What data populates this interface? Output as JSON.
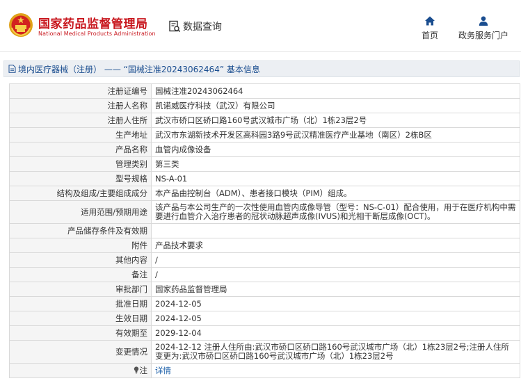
{
  "header": {
    "brand_cn": "国家药品监督管理局",
    "brand_en": "National Medical Products Administration",
    "data_query_label": "数据查询",
    "nav": {
      "home_label": "首页",
      "gov_service_label": "政务服务门户"
    }
  },
  "breadcrumb": {
    "text": "境内医疗器械（注册） —— “国械注准20243062464” 基本信息"
  },
  "table": {
    "rows": [
      {
        "label": "注册证编号",
        "value": "国械注准20243062464"
      },
      {
        "label": "注册人名称",
        "value": "凯诺威医疗科技（武汉）有限公司"
      },
      {
        "label": "注册人住所",
        "value": "武汉市硚口区硚口路160号武汉城市广场（北）1栋23层2号"
      },
      {
        "label": "生产地址",
        "value": "武汉市东湖新技术开发区高科园3路9号武汉精准医疗产业基地（南区）2栋B区"
      },
      {
        "label": "产品名称",
        "value": "血管内成像设备"
      },
      {
        "label": "管理类别",
        "value": "第三类"
      },
      {
        "label": "型号规格",
        "value": "NS-A-01"
      },
      {
        "label": "结构及组成/主要组成成分",
        "value": "本产品由控制台（ADM）、患者接口模块（PIM）组成。"
      },
      {
        "label": "适用范围/预期用途",
        "value": "该产品与本公司生产的一次性使用血管内成像导管（型号：NS-C-01）配合使用，用于在医疗机构中需要进行血管介入治疗患者的冠状动脉超声成像(IVUS)和光相干断层成像(OCT)。"
      },
      {
        "label": "产品储存条件及有效期",
        "value": ""
      },
      {
        "label": "附件",
        "value": "产品技术要求"
      },
      {
        "label": "其他内容",
        "value": "/"
      },
      {
        "label": "备注",
        "value": "/"
      },
      {
        "label": "审批部门",
        "value": "国家药品监督管理局"
      },
      {
        "label": "批准日期",
        "value": "2024-12-05"
      },
      {
        "label": "生效日期",
        "value": "2024-12-05"
      },
      {
        "label": "有效期至",
        "value": "2029-12-04"
      },
      {
        "label": "变更情况",
        "value": "2024-12-12 注册人住所由:武汉市硚口区硚口路160号武汉城市广场（北）1栋23层2号;注册人住所变更为:武汉市硚口区硚口路160号武汉城市广场（北）1栋23层2号"
      },
      {
        "label": "注",
        "value": "详情"
      }
    ]
  },
  "icons": {
    "logo": "emblem-logo",
    "data_query": "document-search-icon",
    "home": "home-icon",
    "gov_service": "user-icon",
    "breadcrumb": "document-icon",
    "note": "lightbulb-icon"
  },
  "colors": {
    "brand_red": "#c8161d",
    "nav_blue": "#1a4d8f",
    "link_blue": "#1a5ea8",
    "label_bg": "#f5f5f5",
    "breadcrumb_bg": "#eceff3"
  }
}
